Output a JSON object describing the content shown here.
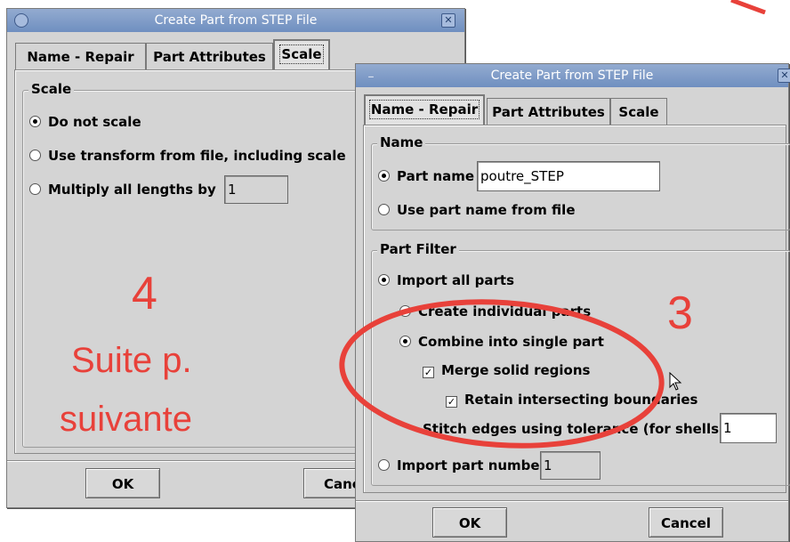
{
  "back_window": {
    "title": "Create Part from STEP File",
    "tabs": [
      {
        "label": "Name - Repair"
      },
      {
        "label": "Part Attributes"
      },
      {
        "label": "Scale"
      }
    ],
    "scale_group": {
      "legend": "Scale",
      "option_no_scale": "Do not scale",
      "option_transform": "Use transform from file, including scale",
      "option_multiply": "Multiply all lengths by",
      "multiply_value": "1"
    },
    "ok_label": "OK",
    "cancel_label": "Canc"
  },
  "front_window": {
    "title": "Create Part from STEP File",
    "tabs": [
      {
        "label": "Name - Repair"
      },
      {
        "label": "Part Attributes"
      },
      {
        "label": "Scale"
      }
    ],
    "name_group": {
      "legend": "Name",
      "part_name_label": "Part name",
      "part_name_value": "poutre_STEP",
      "use_file_name_label": "Use part name from file"
    },
    "filter_group": {
      "legend": "Part Filter",
      "import_all_label": "Import all parts",
      "create_individual_label": "Create individual parts",
      "combine_label": "Combine into single part",
      "merge_label": "Merge solid regions",
      "retain_label": "Retain intersecting boundaries",
      "stitch_label": "Stitch edges using tolerance (for shells)",
      "stitch_value": "1",
      "import_number_label": "Import part number",
      "import_number_value": "1"
    },
    "ok_label": "OK",
    "cancel_label": "Cancel"
  },
  "annotations": {
    "step_four": "4",
    "note_line1": "Suite p.",
    "note_line2": "suivante",
    "step_three": "3",
    "color": "#e8413a"
  }
}
